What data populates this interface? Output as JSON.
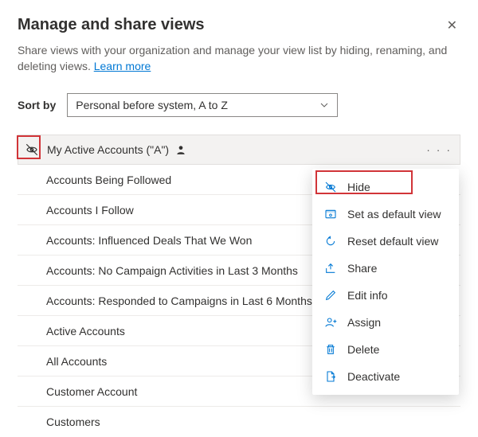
{
  "header": {
    "title": "Manage and share views",
    "subtitle_prefix": "Share views with your organization and manage your view list by hiding, renaming, and deleting views. ",
    "learn_more": "Learn more"
  },
  "sort": {
    "label": "Sort by",
    "value": "Personal before system, A to Z"
  },
  "views": [
    {
      "name": "My Active Accounts (\"A\")",
      "active": true,
      "personal": true
    },
    {
      "name": "Accounts Being Followed"
    },
    {
      "name": "Accounts I Follow"
    },
    {
      "name": "Accounts: Influenced Deals That We Won"
    },
    {
      "name": "Accounts: No Campaign Activities in Last 3 Months"
    },
    {
      "name": "Accounts: Responded to Campaigns in Last 6 Months"
    },
    {
      "name": "Active Accounts"
    },
    {
      "name": "All Accounts"
    },
    {
      "name": "Customer Account"
    },
    {
      "name": "Customers"
    }
  ],
  "menu": {
    "items": [
      {
        "icon": "hide",
        "label": "Hide"
      },
      {
        "icon": "default",
        "label": "Set as default view"
      },
      {
        "icon": "reset",
        "label": "Reset default view"
      },
      {
        "icon": "share",
        "label": "Share"
      },
      {
        "icon": "edit",
        "label": "Edit info"
      },
      {
        "icon": "assign",
        "label": "Assign"
      },
      {
        "icon": "delete",
        "label": "Delete"
      },
      {
        "icon": "deactivate",
        "label": "Deactivate"
      }
    ]
  }
}
